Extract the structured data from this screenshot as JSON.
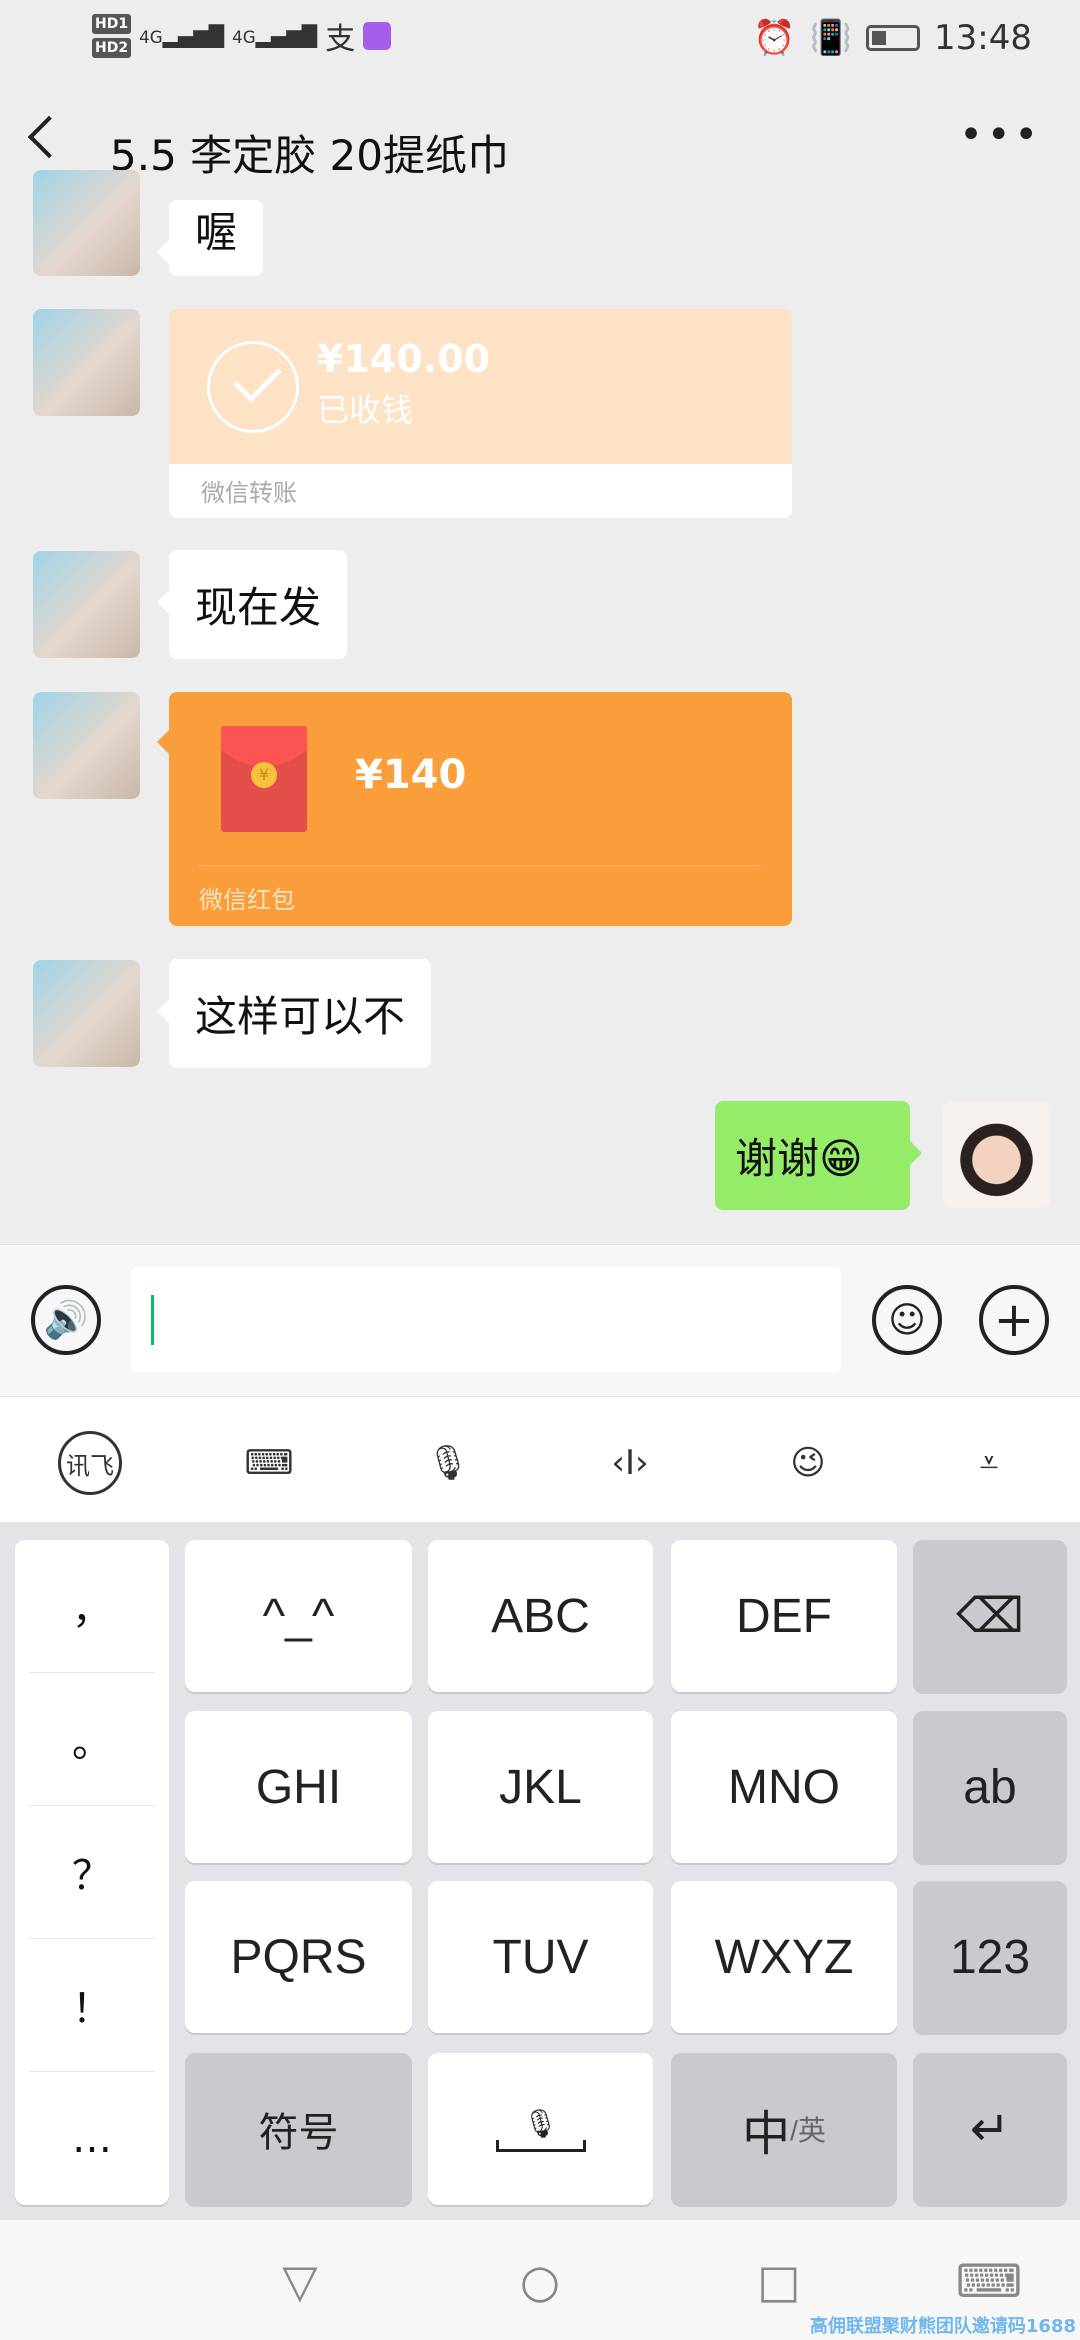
{
  "status_bar": {
    "sim1": "HD1",
    "sim2": "HD2",
    "network": "4G",
    "alipay_icon": "支",
    "time": "13:48"
  },
  "header": {
    "title": "5.5 李定胶 20提纸巾",
    "back_icon": "chevron-left-icon",
    "more_icon": "more-icon"
  },
  "messages": [
    {
      "type": "text",
      "from": "other",
      "text": "喔"
    },
    {
      "type": "transfer",
      "from": "other",
      "amount": "¥140.00",
      "status": "已收钱",
      "footer": "微信转账"
    },
    {
      "type": "text",
      "from": "other",
      "text": "现在发"
    },
    {
      "type": "red_packet",
      "from": "other",
      "amount": "¥140",
      "footer": "微信红包"
    },
    {
      "type": "text",
      "from": "other",
      "text": "这样可以不"
    },
    {
      "type": "text",
      "from": "me",
      "text": "谢谢😁"
    }
  ],
  "input": {
    "value": ""
  },
  "keyboard": {
    "punctuation": [
      "，",
      "。",
      "？",
      "！",
      "…"
    ],
    "rows": [
      [
        "^_^",
        "ABC",
        "DEF",
        "⌫"
      ],
      [
        "GHI",
        "JKL",
        "MNO",
        "ab"
      ],
      [
        "PQRS",
        "TUV",
        "WXYZ",
        "123"
      ],
      [
        "符号",
        "space",
        "中",
        "↵"
      ]
    ],
    "lang_alt": "/英"
  },
  "watermark": "高佣联盟聚财熊团队邀请码1688",
  "colors": {
    "bg": "#ededed",
    "my_bubble": "#95ec69",
    "red_packet": "#fa9d3b",
    "transfer_received": "#fde2c5"
  }
}
